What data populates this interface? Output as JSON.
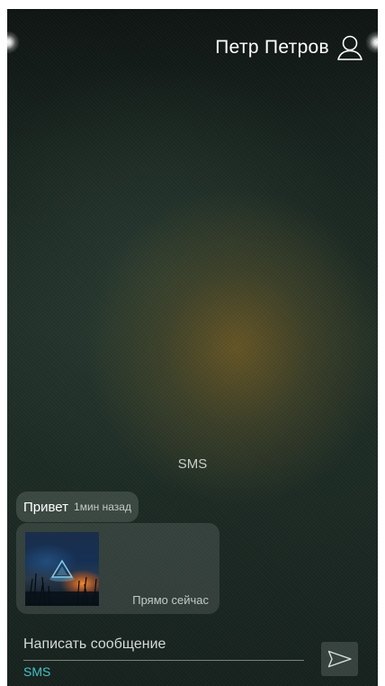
{
  "header": {
    "contact_name": "Петр Петров",
    "user_icon": "user-outline-icon"
  },
  "conversation": {
    "channel_label": "SMS",
    "messages": [
      {
        "type": "text",
        "text": "Привет",
        "time": "1мин назад"
      },
      {
        "type": "image",
        "time": "Прямо сейчас",
        "thumbnail_icon": "photo-thumbnail"
      }
    ]
  },
  "composer": {
    "placeholder": "Написать сообщение",
    "channel": "SMS",
    "send_icon": "send-icon"
  },
  "colors": {
    "accent": "#44c3c9",
    "text_primary": "#ffffff",
    "bubble": "#c8d2cd"
  }
}
